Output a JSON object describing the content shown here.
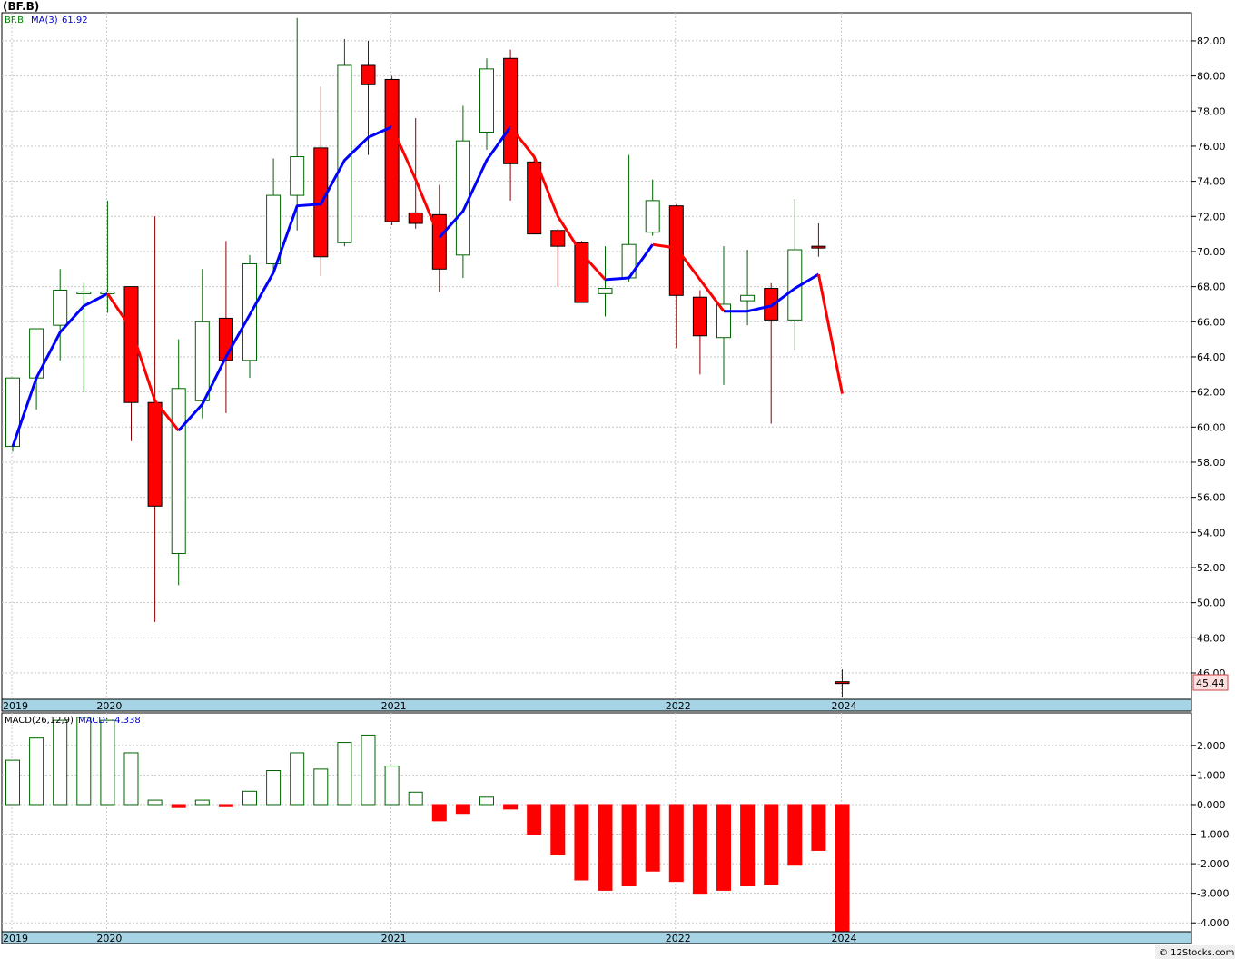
{
  "title": "(BF.B)",
  "watermark": "© 12Stocks.com",
  "chart_data": [
    {
      "type": "candlestick",
      "legend": {
        "ticker": "BF.B",
        "ma_label": "MA(3)",
        "ma_value": "61.92"
      },
      "price_tag": "45.44",
      "ylim": [
        44.5,
        83.6
      ],
      "yticks": [
        46,
        48,
        50,
        52,
        54,
        56,
        58,
        60,
        62,
        64,
        66,
        68,
        70,
        72,
        74,
        76,
        78,
        80,
        82
      ],
      "ytick_labels": [
        "46.00",
        "48.00",
        "50.00",
        "52.00",
        "54.00",
        "56.00",
        "58.00",
        "60.00",
        "62.00",
        "64.00",
        "66.00",
        "68.00",
        "70.00",
        "72.00",
        "74.00",
        "76.00",
        "78.00",
        "80.00",
        "82.00"
      ],
      "x_labels": [
        {
          "label": "2019",
          "index": 0
        },
        {
          "label": "2020",
          "index": 4
        },
        {
          "label": "2021",
          "index": 16
        },
        {
          "label": "2022",
          "index": 28
        },
        {
          "label": "2024",
          "index": 35
        }
      ],
      "candles": [
        {
          "o": 58.9,
          "h": 60.1,
          "l": 58.6,
          "c": 62.8
        },
        {
          "o": 62.8,
          "h": 65.5,
          "l": 61.0,
          "c": 65.6
        },
        {
          "o": 65.8,
          "h": 69.0,
          "l": 63.8,
          "c": 67.8
        },
        {
          "o": 67.6,
          "h": 68.2,
          "l": 62.0,
          "c": 67.7
        },
        {
          "o": 67.6,
          "h": 72.9,
          "l": 66.5,
          "c": 67.7
        },
        {
          "o": 68.0,
          "h": 68.0,
          "l": 59.2,
          "c": 61.4
        },
        {
          "o": 61.4,
          "h": 72.0,
          "l": 48.9,
          "c": 55.5
        },
        {
          "o": 52.8,
          "h": 65.0,
          "l": 51.0,
          "c": 62.2
        },
        {
          "o": 61.5,
          "h": 69.0,
          "l": 60.5,
          "c": 66.0
        },
        {
          "o": 66.2,
          "h": 70.6,
          "l": 60.8,
          "c": 63.8
        },
        {
          "o": 63.8,
          "h": 69.8,
          "l": 62.8,
          "c": 69.3
        },
        {
          "o": 69.3,
          "h": 75.3,
          "l": 68.8,
          "c": 73.2
        },
        {
          "o": 73.2,
          "h": 83.3,
          "l": 71.2,
          "c": 75.4
        },
        {
          "o": 75.9,
          "h": 79.4,
          "l": 68.6,
          "c": 69.7
        },
        {
          "o": 70.5,
          "h": 82.1,
          "l": 70.3,
          "c": 80.6
        },
        {
          "o": 80.6,
          "h": 82.0,
          "l": 75.5,
          "c": 79.5
        },
        {
          "o": 79.8,
          "h": 80.0,
          "l": 71.5,
          "c": 71.7
        },
        {
          "o": 72.2,
          "h": 77.6,
          "l": 71.3,
          "c": 71.6
        },
        {
          "o": 72.1,
          "h": 73.8,
          "l": 67.7,
          "c": 69.0
        },
        {
          "o": 69.8,
          "h": 78.3,
          "l": 68.5,
          "c": 76.3
        },
        {
          "o": 76.8,
          "h": 81.0,
          "l": 75.8,
          "c": 80.4
        },
        {
          "o": 81.0,
          "h": 81.5,
          "l": 72.9,
          "c": 75.0
        },
        {
          "o": 75.1,
          "h": 75.5,
          "l": 71.0,
          "c": 71.0
        },
        {
          "o": 71.2,
          "h": 71.3,
          "l": 68.0,
          "c": 70.3
        },
        {
          "o": 70.5,
          "h": 70.6,
          "l": 67.2,
          "c": 67.1
        },
        {
          "o": 67.6,
          "h": 70.3,
          "l": 66.3,
          "c": 67.9
        },
        {
          "o": 68.5,
          "h": 75.5,
          "l": 68.3,
          "c": 70.4
        },
        {
          "o": 71.1,
          "h": 74.1,
          "l": 70.9,
          "c": 72.9
        },
        {
          "o": 72.6,
          "h": 72.7,
          "l": 64.5,
          "c": 67.5
        },
        {
          "o": 67.4,
          "h": 67.8,
          "l": 63.0,
          "c": 65.2
        },
        {
          "o": 65.1,
          "h": 70.3,
          "l": 62.4,
          "c": 67.0
        },
        {
          "o": 67.2,
          "h": 70.1,
          "l": 65.8,
          "c": 67.5
        },
        {
          "o": 67.9,
          "h": 68.2,
          "l": 60.2,
          "c": 66.1
        },
        {
          "o": 66.1,
          "h": 73.0,
          "l": 64.4,
          "c": 70.1
        },
        {
          "o": 70.3,
          "h": 71.6,
          "l": 69.7,
          "c": 70.2
        },
        {
          "o": 45.5,
          "h": 46.2,
          "l": 44.6,
          "c": 45.4
        }
      ],
      "ma_segments": [
        {
          "color": "#0000ff",
          "points": [
            [
              0,
              58.9
            ],
            [
              1,
              62.8
            ],
            [
              2,
              65.4
            ],
            [
              3,
              66.9
            ],
            [
              4,
              67.6
            ]
          ]
        },
        {
          "color": "#ff0000",
          "points": [
            [
              4,
              67.6
            ],
            [
              5,
              65.6
            ],
            [
              6,
              61.5
            ],
            [
              7,
              59.8
            ]
          ]
        },
        {
          "color": "#0000ff",
          "points": [
            [
              7,
              59.8
            ],
            [
              8,
              61.3
            ],
            [
              9,
              64.0
            ],
            [
              10,
              66.4
            ],
            [
              11,
              68.8
            ],
            [
              12,
              72.6
            ],
            [
              13,
              72.7
            ],
            [
              14,
              75.2
            ],
            [
              15,
              76.5
            ],
            [
              16,
              77.1
            ]
          ]
        },
        {
          "color": "#ff0000",
          "points": [
            [
              16,
              77.1
            ],
            [
              17,
              74.1
            ],
            [
              18,
              70.8
            ]
          ]
        },
        {
          "color": "#0000ff",
          "points": [
            [
              18,
              70.8
            ],
            [
              19,
              72.3
            ],
            [
              20,
              75.2
            ],
            [
              21,
              77.1
            ]
          ]
        },
        {
          "color": "#ff0000",
          "points": [
            [
              21,
              77.1
            ],
            [
              22,
              75.4
            ],
            [
              23,
              72.0
            ],
            [
              24,
              69.9
            ],
            [
              25,
              68.4
            ]
          ]
        },
        {
          "color": "#0000ff",
          "points": [
            [
              25,
              68.4
            ],
            [
              26,
              68.5
            ],
            [
              27,
              70.4
            ]
          ]
        },
        {
          "color": "#ff0000",
          "points": [
            [
              27,
              70.4
            ],
            [
              28,
              70.2
            ],
            [
              29,
              68.4
            ],
            [
              30,
              66.6
            ]
          ]
        },
        {
          "color": "#0000ff",
          "points": [
            [
              30,
              66.6
            ],
            [
              31,
              66.6
            ],
            [
              32,
              66.9
            ],
            [
              33,
              67.9
            ],
            [
              34,
              68.7
            ]
          ]
        },
        {
          "color": "#ff0000",
          "points": [
            [
              34,
              68.7
            ],
            [
              35,
              61.9
            ]
          ]
        }
      ]
    },
    {
      "type": "bar",
      "legend": {
        "macd_label": "MACD(26,12,9)",
        "macd_value": "MACD: -4.338"
      },
      "ylim": [
        -4.3,
        3.1
      ],
      "yticks": [
        -4,
        -3,
        -2,
        -1,
        0,
        1,
        2
      ],
      "ytick_labels": [
        "-4.000",
        "-3.000",
        "-2.000",
        "-1.000",
        "0.000",
        "1.000",
        "2.000"
      ],
      "x_labels": [
        {
          "label": "2019",
          "index": 0
        },
        {
          "label": "2020",
          "index": 4
        },
        {
          "label": "2021",
          "index": 16
        },
        {
          "label": "2022",
          "index": 28
        },
        {
          "label": "2024",
          "index": 35
        }
      ],
      "values": [
        1.5,
        2.25,
        2.85,
        2.95,
        2.85,
        1.75,
        0.15,
        -0.1,
        0.15,
        -0.07,
        0.45,
        1.15,
        1.75,
        1.2,
        2.1,
        2.35,
        1.3,
        0.42,
        -0.55,
        -0.3,
        0.25,
        -0.15,
        -1.0,
        -1.7,
        -2.55,
        -2.9,
        -2.75,
        -2.25,
        -2.6,
        -3.0,
        -2.9,
        -2.75,
        -2.7,
        -2.05,
        -1.55,
        -4.338
      ]
    }
  ]
}
